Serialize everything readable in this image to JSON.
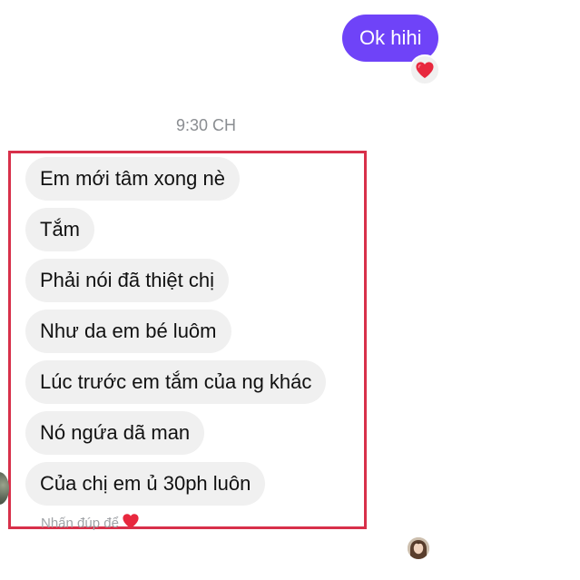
{
  "chat": {
    "sent_message": "Ok hihi",
    "sent_reaction": "heart-icon",
    "timestamp": "9:30 CH",
    "received_messages": [
      "Em mới tâm xong nè",
      "Tắm",
      "Phải nói đã thiệt chị",
      "Như da em bé luôm",
      "Lúc trước em tắm của ng khác",
      "Nó ngứa dã man",
      "Của chị em ủ 30ph luôn"
    ],
    "double_tap_hint": "Nhấn đúp để"
  },
  "colors": {
    "sent_bubble": "#6f43f8",
    "received_bubble": "#f0f0f0",
    "highlight_border": "#d8304a",
    "heart": "#e8283e"
  }
}
